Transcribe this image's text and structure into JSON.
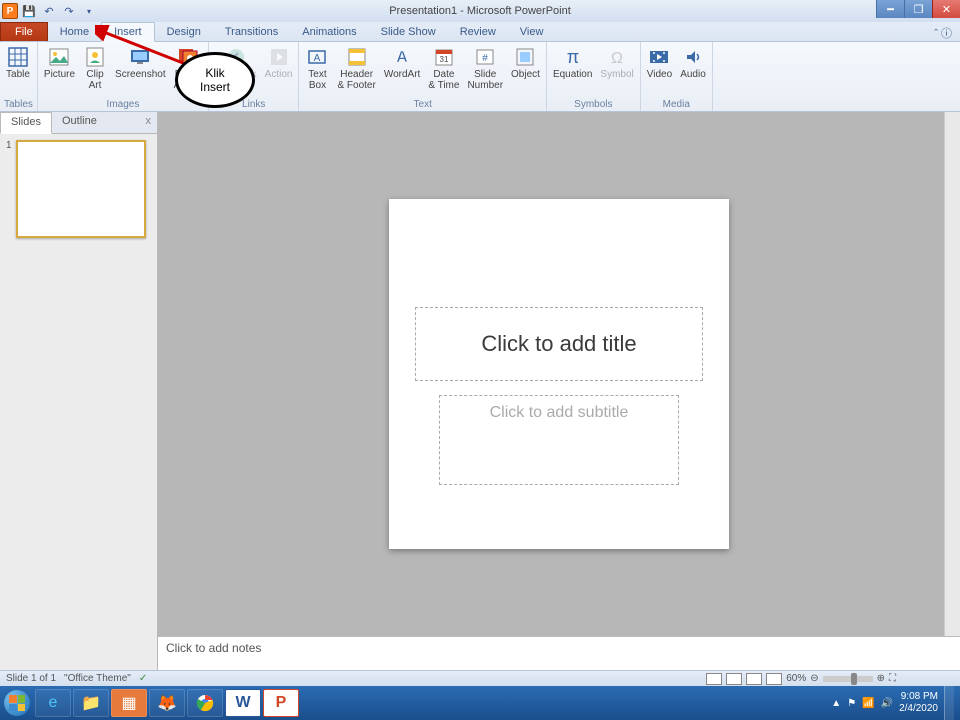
{
  "titlebar": {
    "title": "Presentation1 - Microsoft PowerPoint"
  },
  "qat": {
    "app_letter": "P"
  },
  "tabs": {
    "file": "File",
    "items": [
      "Home",
      "Insert",
      "Design",
      "Transitions",
      "Animations",
      "Slide Show",
      "Review",
      "View"
    ],
    "active_index": 1,
    "help": "ˆ ⓘ"
  },
  "ribbon": {
    "groups": [
      {
        "label": "Tables",
        "buttons": [
          {
            "label": "Table",
            "icon": "table-icon"
          }
        ]
      },
      {
        "label": "Images",
        "buttons": [
          {
            "label": "Picture",
            "icon": "picture-icon"
          },
          {
            "label": "Clip\nArt",
            "icon": "clipart-icon"
          },
          {
            "label": "Screenshot",
            "icon": "screenshot-icon"
          },
          {
            "label": "Photo\nAlbum",
            "icon": "album-icon"
          }
        ]
      },
      {
        "label": "Links",
        "buttons": [
          {
            "label": "Hyperlink",
            "icon": "link-icon",
            "disabled": true
          },
          {
            "label": "Action",
            "icon": "action-icon",
            "disabled": true
          }
        ]
      },
      {
        "label": "Text",
        "buttons": [
          {
            "label": "Text\nBox",
            "icon": "textbox-icon"
          },
          {
            "label": "Header\n& Footer",
            "icon": "header-icon"
          },
          {
            "label": "WordArt",
            "icon": "wordart-icon"
          },
          {
            "label": "Date\n& Time",
            "icon": "date-icon"
          },
          {
            "label": "Slide\nNumber",
            "icon": "slidenum-icon"
          },
          {
            "label": "Object",
            "icon": "object-icon"
          }
        ]
      },
      {
        "label": "Symbols",
        "buttons": [
          {
            "label": "Equation",
            "icon": "equation-icon"
          },
          {
            "label": "Symbol",
            "icon": "symbol-icon",
            "disabled": true
          }
        ]
      },
      {
        "label": "Media",
        "buttons": [
          {
            "label": "Video",
            "icon": "video-icon"
          },
          {
            "label": "Audio",
            "icon": "audio-icon"
          }
        ]
      }
    ]
  },
  "leftpanel": {
    "tab_slides": "Slides",
    "tab_outline": "Outline",
    "slide_num": "1"
  },
  "slide": {
    "title_ph": "Click to add title",
    "subtitle_ph": "Click to add subtitle"
  },
  "notes": {
    "placeholder": "Click to add notes"
  },
  "status": {
    "slide": "Slide 1 of 1",
    "theme": "\"Office Theme\"",
    "zoom": "60%"
  },
  "annotation": {
    "text": "Klik\nInsert"
  },
  "taskbar": {
    "time": "9:08 PM",
    "date": "2/4/2020"
  }
}
